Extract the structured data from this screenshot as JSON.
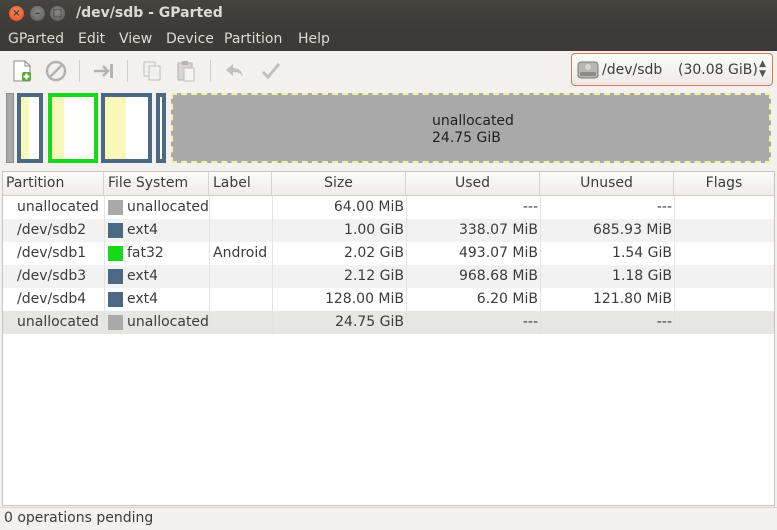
{
  "window": {
    "title": "/dev/sdb - GParted"
  },
  "menu": [
    "GParted",
    "Edit",
    "View",
    "Device",
    "Partition",
    "Help"
  ],
  "toolbar": {
    "buttons": [
      "new-partition-icon",
      "delete-icon",
      "resize-move-icon",
      "copy-icon",
      "paste-icon",
      "undo-icon",
      "apply-icon"
    ]
  },
  "device": {
    "name": "/dev/sdb",
    "size": "(30.08 GiB)"
  },
  "map": {
    "unallocated_label": "unallocated",
    "unallocated_size": "24.75 GiB"
  },
  "colors": {
    "ext4": "#4b6983",
    "fat32": "#18d918",
    "unallocated": "#a9a9a9",
    "used_fill": "#f8f8ba",
    "selection_outline": "#f2f2a5"
  },
  "table": {
    "headers": [
      "Partition",
      "File System",
      "Label",
      "Size",
      "Used",
      "Unused",
      "Flags"
    ],
    "rows": [
      {
        "partition": "unallocated",
        "fs": "unallocated",
        "fs_color": "#a9a9a9",
        "label": "",
        "size": "64.00 MiB",
        "used": "---",
        "unused": "---",
        "flags": ""
      },
      {
        "partition": "/dev/sdb2",
        "fs": "ext4",
        "fs_color": "#4b6983",
        "label": "",
        "size": "1.00 GiB",
        "used": "338.07 MiB",
        "unused": "685.93 MiB",
        "flags": ""
      },
      {
        "partition": "/dev/sdb1",
        "fs": "fat32",
        "fs_color": "#18d918",
        "label": "Android",
        "size": "2.02 GiB",
        "used": "493.07 MiB",
        "unused": "1.54 GiB",
        "flags": ""
      },
      {
        "partition": "/dev/sdb3",
        "fs": "ext4",
        "fs_color": "#4b6983",
        "label": "",
        "size": "2.12 GiB",
        "used": "968.68 MiB",
        "unused": "1.18 GiB",
        "flags": ""
      },
      {
        "partition": "/dev/sdb4",
        "fs": "ext4",
        "fs_color": "#4b6983",
        "label": "",
        "size": "128.00 MiB",
        "used": "6.20 MiB",
        "unused": "121.80 MiB",
        "flags": ""
      },
      {
        "partition": "unallocated",
        "fs": "unallocated",
        "fs_color": "#a9a9a9",
        "label": "",
        "size": "24.75 GiB",
        "used": "---",
        "unused": "---",
        "flags": ""
      }
    ]
  },
  "status": "0 operations pending"
}
